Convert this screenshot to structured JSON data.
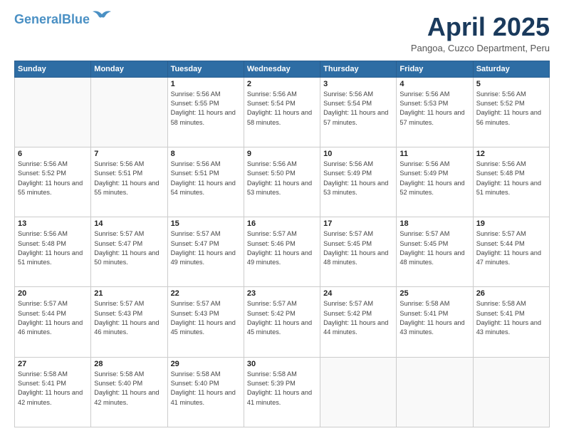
{
  "logo": {
    "line1": "General",
    "line2": "Blue"
  },
  "title": "April 2025",
  "subtitle": "Pangoa, Cuzco Department, Peru",
  "headers": [
    "Sunday",
    "Monday",
    "Tuesday",
    "Wednesday",
    "Thursday",
    "Friday",
    "Saturday"
  ],
  "weeks": [
    [
      {
        "num": "",
        "sunrise": "",
        "sunset": "",
        "daylight": "",
        "empty": true
      },
      {
        "num": "",
        "sunrise": "",
        "sunset": "",
        "daylight": "",
        "empty": true
      },
      {
        "num": "1",
        "sunrise": "Sunrise: 5:56 AM",
        "sunset": "Sunset: 5:55 PM",
        "daylight": "Daylight: 11 hours and 58 minutes.",
        "empty": false
      },
      {
        "num": "2",
        "sunrise": "Sunrise: 5:56 AM",
        "sunset": "Sunset: 5:54 PM",
        "daylight": "Daylight: 11 hours and 58 minutes.",
        "empty": false
      },
      {
        "num": "3",
        "sunrise": "Sunrise: 5:56 AM",
        "sunset": "Sunset: 5:54 PM",
        "daylight": "Daylight: 11 hours and 57 minutes.",
        "empty": false
      },
      {
        "num": "4",
        "sunrise": "Sunrise: 5:56 AM",
        "sunset": "Sunset: 5:53 PM",
        "daylight": "Daylight: 11 hours and 57 minutes.",
        "empty": false
      },
      {
        "num": "5",
        "sunrise": "Sunrise: 5:56 AM",
        "sunset": "Sunset: 5:52 PM",
        "daylight": "Daylight: 11 hours and 56 minutes.",
        "empty": false
      }
    ],
    [
      {
        "num": "6",
        "sunrise": "Sunrise: 5:56 AM",
        "sunset": "Sunset: 5:52 PM",
        "daylight": "Daylight: 11 hours and 55 minutes.",
        "empty": false
      },
      {
        "num": "7",
        "sunrise": "Sunrise: 5:56 AM",
        "sunset": "Sunset: 5:51 PM",
        "daylight": "Daylight: 11 hours and 55 minutes.",
        "empty": false
      },
      {
        "num": "8",
        "sunrise": "Sunrise: 5:56 AM",
        "sunset": "Sunset: 5:51 PM",
        "daylight": "Daylight: 11 hours and 54 minutes.",
        "empty": false
      },
      {
        "num": "9",
        "sunrise": "Sunrise: 5:56 AM",
        "sunset": "Sunset: 5:50 PM",
        "daylight": "Daylight: 11 hours and 53 minutes.",
        "empty": false
      },
      {
        "num": "10",
        "sunrise": "Sunrise: 5:56 AM",
        "sunset": "Sunset: 5:49 PM",
        "daylight": "Daylight: 11 hours and 53 minutes.",
        "empty": false
      },
      {
        "num": "11",
        "sunrise": "Sunrise: 5:56 AM",
        "sunset": "Sunset: 5:49 PM",
        "daylight": "Daylight: 11 hours and 52 minutes.",
        "empty": false
      },
      {
        "num": "12",
        "sunrise": "Sunrise: 5:56 AM",
        "sunset": "Sunset: 5:48 PM",
        "daylight": "Daylight: 11 hours and 51 minutes.",
        "empty": false
      }
    ],
    [
      {
        "num": "13",
        "sunrise": "Sunrise: 5:56 AM",
        "sunset": "Sunset: 5:48 PM",
        "daylight": "Daylight: 11 hours and 51 minutes.",
        "empty": false
      },
      {
        "num": "14",
        "sunrise": "Sunrise: 5:57 AM",
        "sunset": "Sunset: 5:47 PM",
        "daylight": "Daylight: 11 hours and 50 minutes.",
        "empty": false
      },
      {
        "num": "15",
        "sunrise": "Sunrise: 5:57 AM",
        "sunset": "Sunset: 5:47 PM",
        "daylight": "Daylight: 11 hours and 49 minutes.",
        "empty": false
      },
      {
        "num": "16",
        "sunrise": "Sunrise: 5:57 AM",
        "sunset": "Sunset: 5:46 PM",
        "daylight": "Daylight: 11 hours and 49 minutes.",
        "empty": false
      },
      {
        "num": "17",
        "sunrise": "Sunrise: 5:57 AM",
        "sunset": "Sunset: 5:45 PM",
        "daylight": "Daylight: 11 hours and 48 minutes.",
        "empty": false
      },
      {
        "num": "18",
        "sunrise": "Sunrise: 5:57 AM",
        "sunset": "Sunset: 5:45 PM",
        "daylight": "Daylight: 11 hours and 48 minutes.",
        "empty": false
      },
      {
        "num": "19",
        "sunrise": "Sunrise: 5:57 AM",
        "sunset": "Sunset: 5:44 PM",
        "daylight": "Daylight: 11 hours and 47 minutes.",
        "empty": false
      }
    ],
    [
      {
        "num": "20",
        "sunrise": "Sunrise: 5:57 AM",
        "sunset": "Sunset: 5:44 PM",
        "daylight": "Daylight: 11 hours and 46 minutes.",
        "empty": false
      },
      {
        "num": "21",
        "sunrise": "Sunrise: 5:57 AM",
        "sunset": "Sunset: 5:43 PM",
        "daylight": "Daylight: 11 hours and 46 minutes.",
        "empty": false
      },
      {
        "num": "22",
        "sunrise": "Sunrise: 5:57 AM",
        "sunset": "Sunset: 5:43 PM",
        "daylight": "Daylight: 11 hours and 45 minutes.",
        "empty": false
      },
      {
        "num": "23",
        "sunrise": "Sunrise: 5:57 AM",
        "sunset": "Sunset: 5:42 PM",
        "daylight": "Daylight: 11 hours and 45 minutes.",
        "empty": false
      },
      {
        "num": "24",
        "sunrise": "Sunrise: 5:57 AM",
        "sunset": "Sunset: 5:42 PM",
        "daylight": "Daylight: 11 hours and 44 minutes.",
        "empty": false
      },
      {
        "num": "25",
        "sunrise": "Sunrise: 5:58 AM",
        "sunset": "Sunset: 5:41 PM",
        "daylight": "Daylight: 11 hours and 43 minutes.",
        "empty": false
      },
      {
        "num": "26",
        "sunrise": "Sunrise: 5:58 AM",
        "sunset": "Sunset: 5:41 PM",
        "daylight": "Daylight: 11 hours and 43 minutes.",
        "empty": false
      }
    ],
    [
      {
        "num": "27",
        "sunrise": "Sunrise: 5:58 AM",
        "sunset": "Sunset: 5:41 PM",
        "daylight": "Daylight: 11 hours and 42 minutes.",
        "empty": false
      },
      {
        "num": "28",
        "sunrise": "Sunrise: 5:58 AM",
        "sunset": "Sunset: 5:40 PM",
        "daylight": "Daylight: 11 hours and 42 minutes.",
        "empty": false
      },
      {
        "num": "29",
        "sunrise": "Sunrise: 5:58 AM",
        "sunset": "Sunset: 5:40 PM",
        "daylight": "Daylight: 11 hours and 41 minutes.",
        "empty": false
      },
      {
        "num": "30",
        "sunrise": "Sunrise: 5:58 AM",
        "sunset": "Sunset: 5:39 PM",
        "daylight": "Daylight: 11 hours and 41 minutes.",
        "empty": false
      },
      {
        "num": "",
        "sunrise": "",
        "sunset": "",
        "daylight": "",
        "empty": true
      },
      {
        "num": "",
        "sunrise": "",
        "sunset": "",
        "daylight": "",
        "empty": true
      },
      {
        "num": "",
        "sunrise": "",
        "sunset": "",
        "daylight": "",
        "empty": true
      }
    ]
  ]
}
